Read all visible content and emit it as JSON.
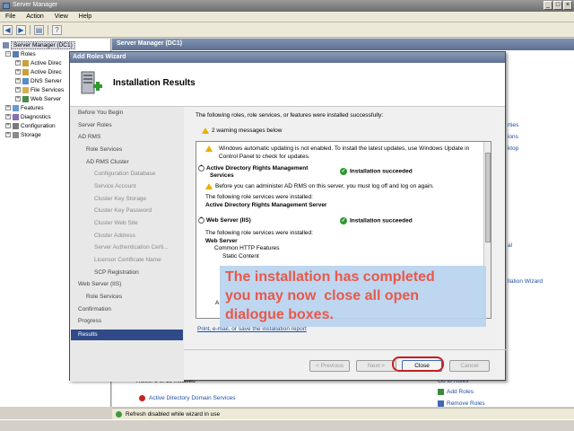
{
  "window": {
    "title": "Server Manager",
    "controls": [
      "_",
      "□",
      "×"
    ]
  },
  "menu": [
    "File",
    "Action",
    "View",
    "Help"
  ],
  "tree": {
    "root": "Server Manager (DC1)",
    "roles": "Roles",
    "role_items": [
      "Active Direc",
      "Active Direc",
      "DNS Server",
      "File Services",
      "Web Server"
    ],
    "other_items": [
      "Features",
      "Diagnostics",
      "Configuration",
      "Storage"
    ]
  },
  "right_pane": {
    "header": "Server Manager (DC1)",
    "partial_links": [
      "rties",
      "ions",
      "ktop",
      "al",
      "llation Wizard"
    ],
    "roles_line": "Roles: 5 of 18 installed",
    "ad_domain": "Active Directory Domain Services",
    "right_links": [
      "Go to Roles",
      "Add Roles",
      "Remove Roles"
    ]
  },
  "status": {
    "text": "Refresh disabled while wizard in use"
  },
  "wizard": {
    "title": "Add Roles Wizard",
    "heading": "Installation Results",
    "nav": [
      "Before You Begin",
      "Server Roles",
      "AD RMS",
      "Role Services",
      "AD RMS Cluster",
      "Configuration Database",
      "Service Account",
      "Cluster Key Storage",
      "Cluster Key Password",
      "Cluster Web Site",
      "Cluster Address",
      "Server Authentication Certi...",
      "Licensor Certificate Name",
      "SCP Registration",
      "Web Server (IIS)",
      "Role Services",
      "Confirmation",
      "Progress",
      "Results"
    ],
    "intro": "The following roles, role services, or features were installed successfully:",
    "warnings": "2 warning messages below",
    "results": {
      "update_warning_1": "Windows automatic updating is not enabled. To install the latest updates, use Windows Update in",
      "update_warning_2": "Control Panel to check for updates.",
      "adrms_title_1": "Active Directory Rights Management",
      "adrms_title_2": "Services",
      "adrms_status": "Installation succeeded",
      "adrms_warning": "Before you can administer AD RMS on this server, you must log off and log on again.",
      "adrms_services_label": "The following role services were installed:",
      "adrms_service": "Active Directory Rights Management Server",
      "iis_title": "Web Server (IIS)",
      "iis_status": "Installation succeeded",
      "iis_services_label": "The following role services were installed:",
      "iis_service": "Web Server",
      "iis_sub1": "Common HTTP Features",
      "iis_sub2": "Static Content",
      "cut_a": "A"
    },
    "print_link": "Print, e-mail, or save the installation report",
    "buttons": {
      "previous": "< Previous",
      "next": "Next >",
      "close": "Close",
      "cancel": "Cancel"
    }
  },
  "callout": {
    "line1": "The installation has completed",
    "line2": "you may now  close all open",
    "line3": "dialogue boxes."
  }
}
